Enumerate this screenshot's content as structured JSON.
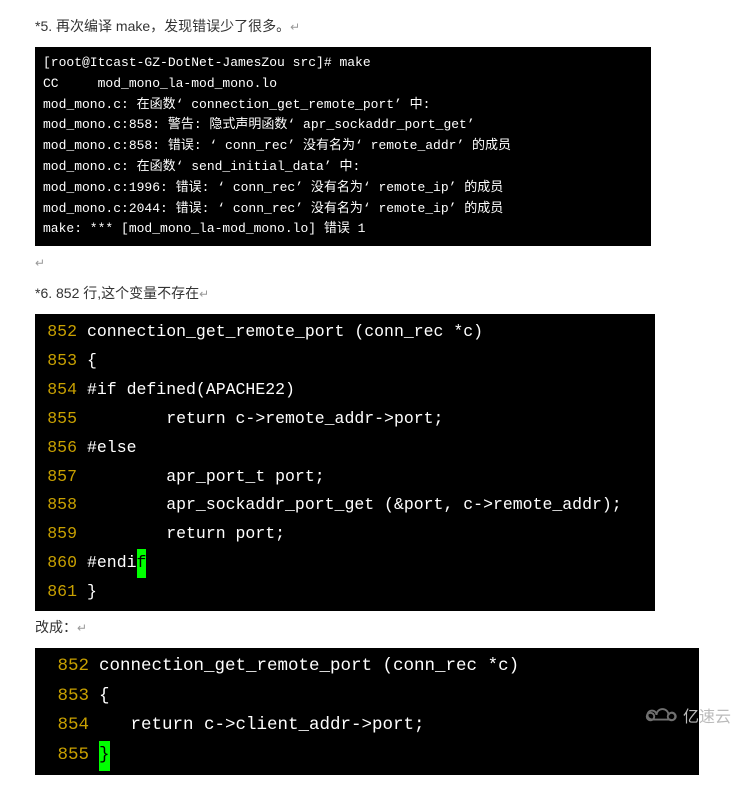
{
  "para1": "*5. 再次编译 make，发现错误少了很多。",
  "para2": "*6. 852 行,这个变量不存在",
  "para3": "改成：",
  "arrow": "↵",
  "terminal1": "[root@Itcast-GZ-DotNet-JamesZou src]# make\nCC     mod_mono_la-mod_mono.lo\nmod_mono.c: 在函数‘ connection_get_remote_port’ 中:\nmod_mono.c:858: 警告: 隐式声明函数‘ apr_sockaddr_port_get’\nmod_mono.c:858: 错误: ‘ conn_rec’ 没有名为‘ remote_addr’ 的成员\nmod_mono.c: 在函数‘ send_initial_data’ 中:\nmod_mono.c:1996: 错误: ‘ conn_rec’ 没有名为‘ remote_ip’ 的成员\nmod_mono.c:2044: 错误: ‘ conn_rec’ 没有名为‘ remote_ip’ 的成员\nmake: *** [mod_mono_la-mod_mono.lo] 错误 1",
  "code1": [
    {
      "ln": "852",
      "txt": "connection_get_remote_port (conn_rec *c)"
    },
    {
      "ln": "853",
      "txt": "{"
    },
    {
      "ln": "854",
      "txt": "#if defined(APACHE22)"
    },
    {
      "ln": "855",
      "txt": "        return c->remote_addr->port;"
    },
    {
      "ln": "856",
      "txt": "#else"
    },
    {
      "ln": "857",
      "txt": "        apr_port_t port;"
    },
    {
      "ln": "858",
      "txt": "        apr_sockaddr_port_get (&port, c->remote_addr);"
    },
    {
      "ln": "859",
      "txt": "        return port;"
    },
    {
      "ln": "860",
      "txt": "#endi",
      "cursor": "f"
    },
    {
      "ln": "861",
      "txt": "}"
    }
  ],
  "code2": [
    {
      "ln": "852",
      "txt": "connection_get_remote_port (conn_rec *c)"
    },
    {
      "ln": "853",
      "txt": "{"
    },
    {
      "ln": "854",
      "txt": "   return c->client_addr->port;"
    },
    {
      "ln": "855",
      "txt": "",
      "cursor": "}"
    }
  ],
  "watermark": "亿速云"
}
